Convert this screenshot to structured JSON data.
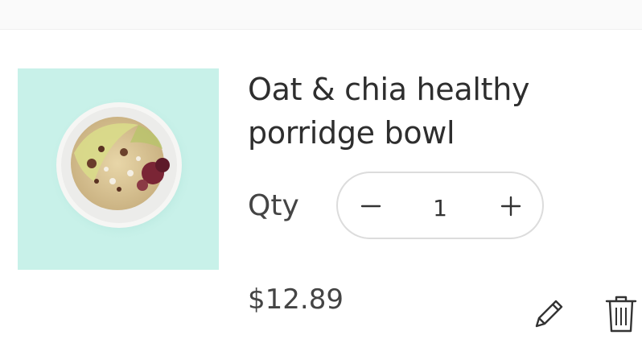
{
  "cart_item": {
    "name": "Oat & chia healthy porridge bowl",
    "image_description": "porridge-bowl-photo",
    "qty_label": "Qty",
    "quantity": "1",
    "price": "$12.89"
  },
  "icons": {
    "decrease": "minus-icon",
    "increase": "plus-icon",
    "edit": "pencil-icon",
    "delete": "trash-icon"
  },
  "colors": {
    "thumb_bg": "#c8f1e9",
    "text": "#2e2e2e",
    "stepper_border": "#dcdcdc"
  }
}
